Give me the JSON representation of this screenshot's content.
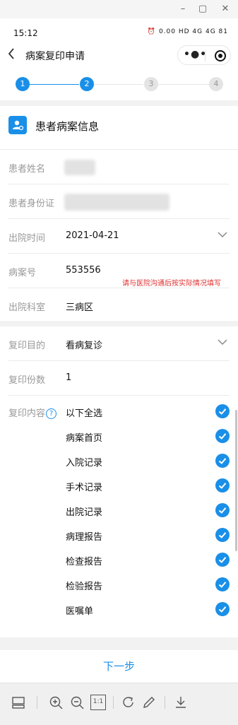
{
  "status_bar": {
    "time": "15:12",
    "indicators": "⏰ 0.00 HD 4G 4G 81"
  },
  "nav": {
    "back_icon": "chevron-left-icon",
    "title": "病案复印申请",
    "more_icon": "more-dots-icon",
    "close_icon": "target-circle-icon"
  },
  "stepper": {
    "steps": [
      "1",
      "2",
      "3",
      "4"
    ],
    "current_step": 2,
    "accent": "#1a8fe8"
  },
  "patient_card": {
    "title": "患者病案信息",
    "icon": "patient-card-icon",
    "fields": {
      "name_label": "患者姓名",
      "id_label": "患者身份证",
      "discharge_time_label": "出院时间",
      "discharge_time_value": "2021-04-21",
      "record_no_label": "病案号",
      "record_no_value": "553556",
      "department_label": "出院科室",
      "department_value": "三病区"
    },
    "note": "请与医院沟通后按实际情况填写"
  },
  "copy_card": {
    "purpose_label": "复印目的",
    "purpose_value": "看病复诊",
    "copies_label": "复印份数",
    "copies_value": "1",
    "content_label": "复印内容",
    "help_mark": "?",
    "items": [
      {
        "label": "以下全选",
        "checked": true
      },
      {
        "label": "病案首页",
        "checked": true
      },
      {
        "label": "入院记录",
        "checked": true
      },
      {
        "label": "手术记录",
        "checked": true
      },
      {
        "label": "出院记录",
        "checked": true
      },
      {
        "label": "病理报告",
        "checked": true
      },
      {
        "label": "检查报告",
        "checked": true
      },
      {
        "label": "检验报告",
        "checked": true
      },
      {
        "label": "医嘱单",
        "checked": true
      }
    ]
  },
  "next_button": "下一步",
  "bottom_toolbar": {
    "icons": [
      "layout-icon",
      "zoom-in-icon",
      "zoom-out-icon",
      "actual-size-icon",
      "rotate-icon",
      "edit-pen-icon",
      "download-icon"
    ],
    "actual_size_label": "1:1"
  },
  "colors": {
    "accent": "#1a8fe8",
    "note_red": "#e03030"
  }
}
